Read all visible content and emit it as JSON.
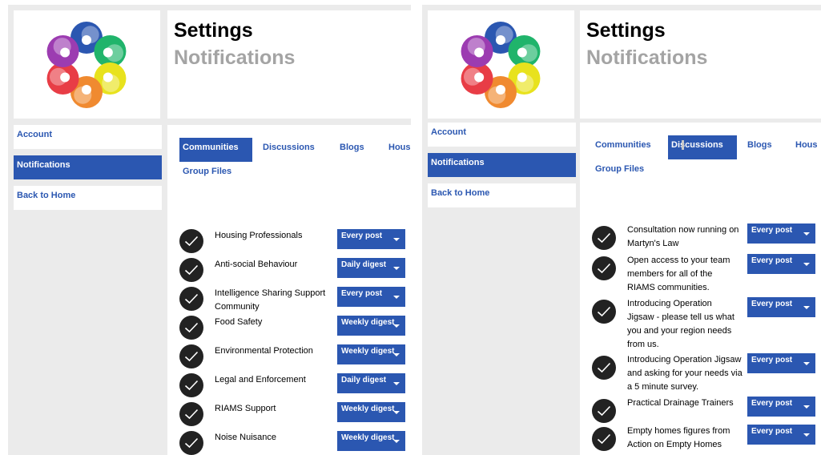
{
  "left": {
    "title": "Settings",
    "subtitle": "Notifications",
    "sidebar": [
      {
        "label": "Account",
        "active": false
      },
      {
        "label": "Notifications",
        "active": true
      },
      {
        "label": "Back to Home",
        "active": false
      }
    ],
    "tabs": [
      {
        "label": "Communities",
        "active": true
      },
      {
        "label": "Discussions",
        "active": false
      },
      {
        "label": "Blogs",
        "active": false
      },
      {
        "label": "Hous",
        "active": false
      },
      {
        "label": "Group Files",
        "active": false
      }
    ],
    "subscriptions": [
      {
        "name": "Housing Professionals",
        "frequency": "Every post"
      },
      {
        "name": "Anti-social Behaviour",
        "frequency": "Daily digest"
      },
      {
        "name": "Intelligence Sharing Support Community",
        "frequency": "Every post"
      },
      {
        "name": "Food Safety",
        "frequency": "Weekly digest"
      },
      {
        "name": "Environmental Protection",
        "frequency": "Weekly digest"
      },
      {
        "name": "Legal and Enforcement",
        "frequency": "Daily digest"
      },
      {
        "name": "RIAMS Support",
        "frequency": "Weekly digest"
      },
      {
        "name": "Noise Nuisance",
        "frequency": "Weekly digest"
      }
    ]
  },
  "right": {
    "title": "Settings",
    "subtitle": "Notifications",
    "sidebar": [
      {
        "label": "Account",
        "active": false
      },
      {
        "label": "Notifications",
        "active": true
      },
      {
        "label": "Back to Home",
        "active": false
      }
    ],
    "tabs": [
      {
        "label": "Communities",
        "active": false
      },
      {
        "label": "Discussions",
        "active": true
      },
      {
        "label": "Blogs",
        "active": false
      },
      {
        "label": "Hous",
        "active": false
      },
      {
        "label": "Group Files",
        "active": false
      }
    ],
    "subscriptions": [
      {
        "name": "Consultation now running on Martyn's Law",
        "frequency": "Every post"
      },
      {
        "name": "Open access to your team members for all of the RIAMS communities.",
        "frequency": "Every post"
      },
      {
        "name": "Introducing Operation Jigsaw - please tell us what you and your region needs from us.",
        "frequency": "Every post"
      },
      {
        "name": "Introducing Operation Jigsaw and asking for your needs via a 5 minute survey.",
        "frequency": "Every post"
      },
      {
        "name": "Practical Drainage Trainers",
        "frequency": "Every post"
      },
      {
        "name": "Empty homes figures from Action on Empty Homes",
        "frequency": "Every post"
      }
    ]
  },
  "colors": {
    "accent": "#2b57b1",
    "panel_bg": "#ebebeb",
    "subtitle": "#a4a4a4",
    "check_bg": "#222222"
  },
  "icons": {
    "logo": "community-circle-logo",
    "check": "check-circle-icon",
    "caret": "caret-down-icon"
  }
}
